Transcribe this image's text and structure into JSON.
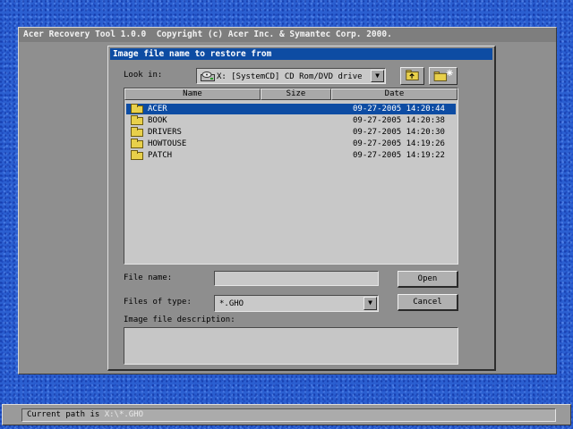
{
  "app": {
    "title": "Acer Recovery Tool 1.0.0  Copyright (c) Acer Inc. & Symantec Corp. 2000."
  },
  "dialog": {
    "title": "Image file name to restore from",
    "look_in_label": "Look in:",
    "look_in_value": "X: [SystemCD] CD Rom/DVD drive",
    "columns": {
      "name": "Name",
      "size": "Size",
      "date": "Date"
    },
    "files": [
      {
        "name": "ACER",
        "size": "",
        "date": "09-27-2005 14:20:44",
        "selected": true
      },
      {
        "name": "BOOK",
        "size": "",
        "date": "09-27-2005 14:20:38",
        "selected": false
      },
      {
        "name": "DRIVERS",
        "size": "",
        "date": "09-27-2005 14:20:30",
        "selected": false
      },
      {
        "name": "HOWTOUSE",
        "size": "",
        "date": "09-27-2005 14:19:26",
        "selected": false
      },
      {
        "name": "PATCH",
        "size": "",
        "date": "09-27-2005 14:19:22",
        "selected": false
      }
    ],
    "file_name_label": "File name:",
    "file_name_value": "",
    "files_of_type_label": "Files of type:",
    "files_of_type_value": "*.GHO",
    "description_label": "Image file description:",
    "description_value": "",
    "open_label": "Open",
    "cancel_label": "Cancel",
    "combo_arrow": "▼"
  },
  "status": {
    "label": "Current path is",
    "path": "X:\\*.GHO"
  },
  "icons": {
    "drive": "cd-drive-icon",
    "up_folder": "up-one-level-icon",
    "new_folder": "new-folder-icon",
    "folder": "folder-icon"
  },
  "colors": {
    "desktop": "#2b5fd0",
    "title_active": "#0d4ca3",
    "selection": "#0d4ca3",
    "folder": "#e8d04a"
  }
}
